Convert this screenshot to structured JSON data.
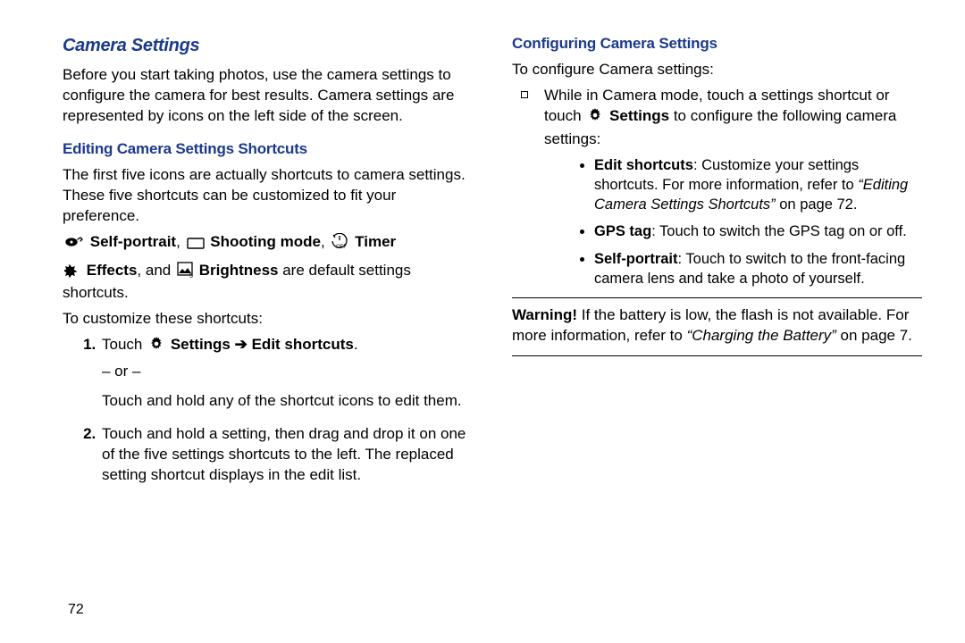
{
  "pageNumber": "72",
  "left": {
    "h1": "Camera Settings",
    "intro": "Before you start taking photos, use the camera settings to configure the camera for best results. Camera settings are represented by icons on the left side of the screen.",
    "sub1": "Editing Camera Settings Shortcuts",
    "shortcutsPara": "The first five icons are actually shortcuts to camera settings. These five shortcuts can be customized to fit your preference.",
    "iconLine": {
      "selfPortrait": "Self-portrait",
      "shootingMode": "Shooting mode",
      "timer": "Timer",
      "effects": "Effects",
      "and": ", and",
      "brightness": "Brightness",
      "tail": " are default settings shortcuts."
    },
    "customizeIntro": "To customize these shortcuts:",
    "step1_touch": "Touch ",
    "step1_settings": "Settings",
    "step1_arrow": " ➔ ",
    "step1_edit": "Edit shortcuts",
    "step1_period": ".",
    "step1_or": "– or –",
    "step1_alt": "Touch and hold any of the shortcut icons to edit them.",
    "step2": "Touch and hold a setting, then drag and drop it on one of the five settings shortcuts to the left. The replaced setting shortcut displays in the edit list."
  },
  "right": {
    "sub1": "Configuring Camera Settings",
    "intro": "To configure Camera settings:",
    "sq1_a": "While in Camera mode, touch a settings shortcut or touch ",
    "sq1_settings": "Settings",
    "sq1_b": " to configure the following camera settings:",
    "b1_lead": "Edit shortcuts",
    "b1_body": ": Customize your settings shortcuts. For more information, refer to ",
    "b1_ref1": "“Editing Camera Settings Shortcuts”",
    "b1_tail": " on page 72.",
    "b2_lead": "GPS tag",
    "b2_body": ": Touch to switch the GPS tag on or off.",
    "b3_lead": "Self-portrait",
    "b3_body": ": Touch to switch to the front-facing camera lens and take a photo of yourself.",
    "warnLead": "Warning!",
    "warnBody_a": " If the battery is low, the flash is not available. For more information, refer to ",
    "warnRef": "“Charging the Battery”",
    "warnBody_b": " on page 7."
  }
}
